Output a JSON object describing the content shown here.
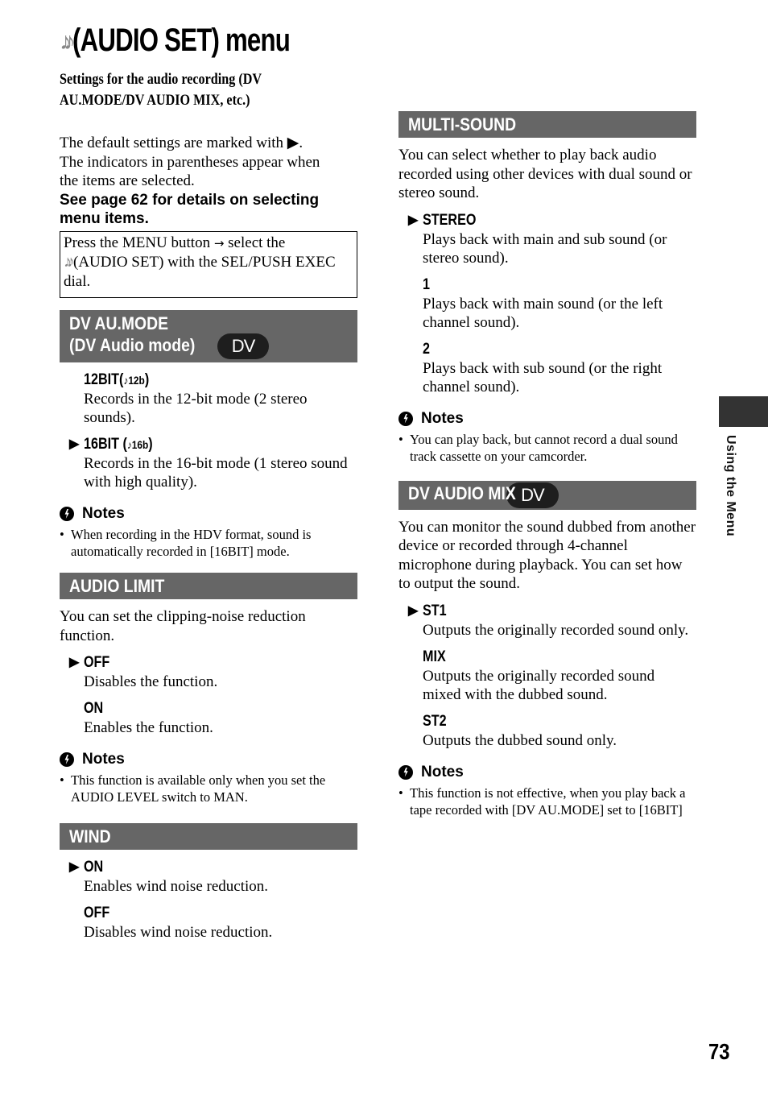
{
  "page": {
    "title": "(AUDIO SET) menu",
    "title_icon": "music-notes-icon",
    "subtitle_lines": [
      "Settings for the audio recording (DV",
      "AU.MODE/DV AUDIO MIX, etc.)"
    ],
    "intro_lines": [
      "The default settings are marked with ▶.",
      "The indicators in parentheses appear when",
      "the items are selected."
    ],
    "see_page": "See page 62 for details on selecting menu items.",
    "procedure": {
      "part1": "Press the MENU button",
      "arrow": "→",
      "part2": "select the",
      "part3": "(AUDIO SET) with the SEL/PUSH EXEC dial."
    },
    "side_tab_label": "Using the Menu",
    "page_number": "73",
    "default_marker": "▶",
    "notes_label": "Notes"
  },
  "sections": {
    "dv_au_mode": {
      "title_line1": "DV AU.MODE",
      "title_line2": "(DV Audio mode)",
      "badge": "DV",
      "options": [
        {
          "label": "12BIT(",
          "indicator": "♪12b",
          "close": ")",
          "default": false,
          "desc": "Records in the 12-bit mode (2 stereo sounds)."
        },
        {
          "label": "16BIT (",
          "indicator": "♪16b",
          "close": ")",
          "default": true,
          "desc": "Records in the 16-bit mode (1 stereo sound with high quality)."
        }
      ],
      "notes": [
        "When recording in the HDV format, sound is automatically recorded in [16BIT] mode."
      ]
    },
    "audio_limit": {
      "title": "AUDIO LIMIT",
      "intro": "You can set the clipping-noise reduction function.",
      "options": [
        {
          "label": "OFF",
          "default": true,
          "desc": "Disables the function."
        },
        {
          "label": "ON",
          "default": false,
          "desc": "Enables the function."
        }
      ],
      "notes": [
        "This function is available only when you set the AUDIO LEVEL switch to MAN."
      ]
    },
    "wind": {
      "title": "WIND",
      "options": [
        {
          "label": "ON",
          "default": true,
          "desc": "Enables wind noise reduction."
        },
        {
          "label": "OFF",
          "default": false,
          "desc": "Disables wind noise reduction."
        }
      ]
    },
    "multi_sound": {
      "title": "MULTI-SOUND",
      "intro": "You can select whether to play back audio recorded using other devices with dual sound or stereo sound.",
      "options": [
        {
          "label": "STEREO",
          "default": true,
          "desc": "Plays back with main and sub sound (or stereo sound)."
        },
        {
          "label": "1",
          "default": false,
          "desc": "Plays back with main sound (or the left channel sound)."
        },
        {
          "label": "2",
          "default": false,
          "desc": "Plays back with sub sound (or the right channel sound)."
        }
      ],
      "notes": [
        "You can play back, but cannot record a dual sound track cassette on your camcorder."
      ]
    },
    "dv_audio_mix": {
      "title": "DV AUDIO MIX",
      "badge": "DV",
      "intro": "You can monitor the sound dubbed from another device or recorded through 4-channel microphone during playback. You can set how to output the sound.",
      "options": [
        {
          "label": "ST1",
          "default": true,
          "desc": "Outputs the originally recorded sound only."
        },
        {
          "label": "MIX",
          "default": false,
          "desc": "Outputs the originally recorded sound mixed with the dubbed sound."
        },
        {
          "label": "ST2",
          "default": false,
          "desc": "Outputs the dubbed sound only."
        }
      ],
      "notes": [
        "This function is not effective, when you play back a tape recorded with [DV AU.MODE] set to [16BIT]"
      ]
    }
  }
}
